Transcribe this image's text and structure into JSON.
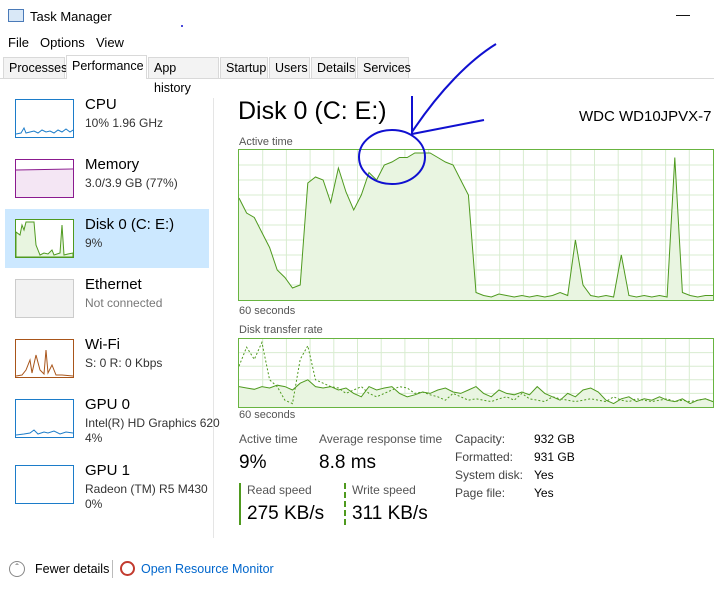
{
  "window": {
    "title": "Task Manager"
  },
  "menu": [
    "File",
    "Options",
    "View"
  ],
  "tabs": [
    "Processes",
    "Performance",
    "App history",
    "Startup",
    "Users",
    "Details",
    "Services"
  ],
  "active_tab": "Performance",
  "resources": [
    {
      "name": "CPU",
      "line1": "10% 1.96 GHz",
      "line2": ""
    },
    {
      "name": "Memory",
      "line1": "3.0/3.9 GB (77%)",
      "line2": ""
    },
    {
      "name": "Disk 0 (C: E:)",
      "line1": "9%",
      "line2": ""
    },
    {
      "name": "Ethernet",
      "line1": "Not connected",
      "line2": ""
    },
    {
      "name": "Wi-Fi",
      "line1": "S: 0 R: 0 Kbps",
      "line2": ""
    },
    {
      "name": "GPU 0",
      "line1": "Intel(R) HD Graphics 620",
      "line2": "4%"
    },
    {
      "name": "GPU 1",
      "line1": "Radeon (TM) R5 M430",
      "line2": "0%"
    }
  ],
  "colors": {
    "disk_green": "#4f9a1f",
    "selected_bg": "#cce8ff",
    "cpu_blue": "#1c7cc9",
    "memory_purple": "#8b1a8f",
    "wifi_brown": "#a8551a",
    "annotation_blue": "#1010d0"
  },
  "main": {
    "title": "Disk 0 (C: E:)",
    "model": "WDC WD10JPVX-7",
    "graph1_label": "Active time",
    "graph1_footer": "60 seconds",
    "graph2_label": "Disk transfer rate",
    "graph2_footer": "60 seconds",
    "stats": {
      "active_time_label": "Active time",
      "active_time_value": "9%",
      "avg_response_label": "Average response time",
      "avg_response_value": "8.8 ms",
      "read_label": "Read speed",
      "read_value": "275 KB/s",
      "write_label": "Write speed",
      "write_value": "311 KB/s"
    },
    "info": [
      {
        "label": "Capacity:",
        "value": "932 GB"
      },
      {
        "label": "Formatted:",
        "value": "931 GB"
      },
      {
        "label": "System disk:",
        "value": "Yes"
      },
      {
        "label": "Page file:",
        "value": "Yes"
      }
    ]
  },
  "chart_data": {
    "type": "area",
    "y_max_percent": 100,
    "active_time_percent": [
      68,
      58,
      55,
      45,
      35,
      20,
      15,
      8,
      10,
      78,
      82,
      80,
      65,
      88,
      72,
      60,
      70,
      85,
      80,
      90,
      92,
      95,
      95,
      98,
      98,
      98,
      95,
      92,
      90,
      80,
      70,
      5,
      3,
      2,
      4,
      3,
      2,
      3,
      2,
      3,
      2,
      3,
      5,
      3,
      40,
      10,
      3,
      2,
      3,
      2,
      30,
      3,
      2,
      3,
      2,
      3,
      2,
      95,
      5,
      3,
      2,
      3,
      3
    ],
    "transfer_read": [
      30,
      28,
      26,
      30,
      28,
      32,
      30,
      25,
      35,
      40,
      30,
      28,
      30,
      25,
      28,
      20,
      15,
      30,
      25,
      28,
      30,
      20,
      15,
      18,
      22,
      20,
      25,
      28,
      22,
      20,
      25,
      30,
      20,
      15,
      25,
      20,
      18,
      22,
      18,
      30,
      20,
      15,
      10,
      20,
      15,
      25,
      28,
      22,
      10,
      5,
      12,
      15,
      8,
      12,
      10,
      15,
      10,
      8,
      12,
      5,
      10,
      12,
      8
    ],
    "transfer_write": [
      60,
      88,
      70,
      95,
      40,
      30,
      10,
      5,
      70,
      90,
      40,
      35,
      30,
      28,
      20,
      25,
      30,
      20,
      15,
      20,
      25,
      30,
      28,
      20,
      22,
      18,
      15,
      10,
      20,
      15,
      10,
      12,
      10,
      8,
      12,
      15,
      10,
      20,
      12,
      10,
      8,
      15,
      12,
      10,
      8,
      10,
      12,
      10,
      8,
      15,
      10,
      8,
      12,
      10,
      8,
      10,
      12,
      8,
      10,
      8,
      10,
      12,
      8
    ]
  },
  "footer": {
    "fewer_details": "Fewer details",
    "open_monitor": "Open Resource Monitor"
  }
}
